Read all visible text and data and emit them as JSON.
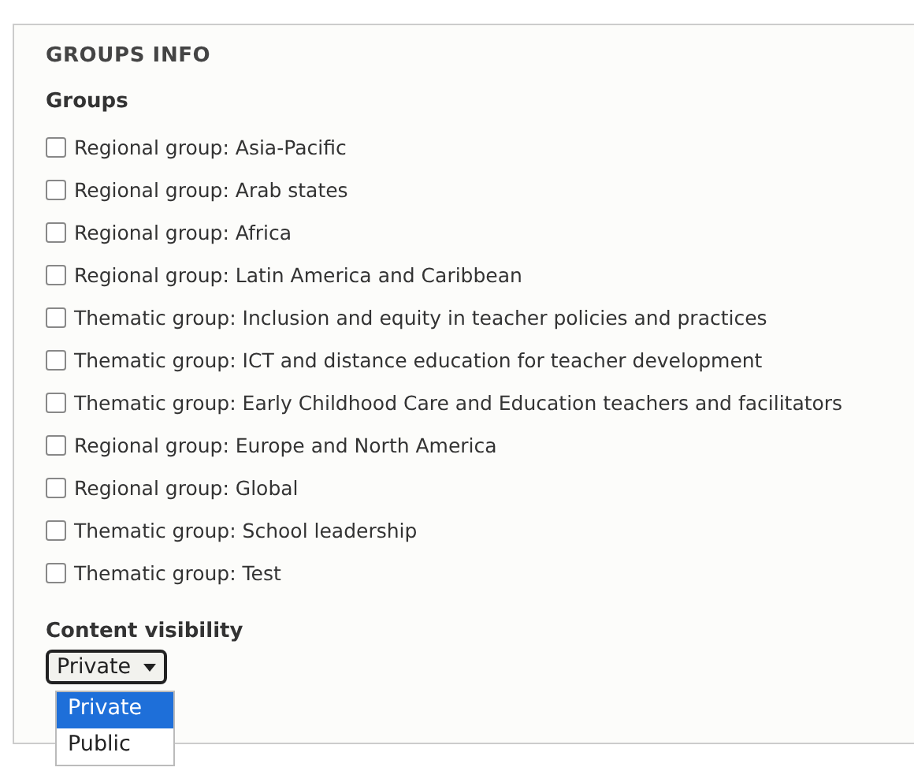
{
  "section": {
    "title": "GROUPS INFO"
  },
  "groups": {
    "label": "Groups",
    "items": [
      {
        "label": "Regional group: Asia-Pacific",
        "checked": false
      },
      {
        "label": "Regional group: Arab states",
        "checked": false
      },
      {
        "label": "Regional group: Africa",
        "checked": false
      },
      {
        "label": "Regional group: Latin America and Caribbean",
        "checked": false
      },
      {
        "label": "Thematic group: Inclusion and equity in teacher policies and practices",
        "checked": false
      },
      {
        "label": "Thematic group: ICT and distance education for teacher development",
        "checked": false
      },
      {
        "label": "Thematic group: Early Childhood Care and Education teachers and facilitators",
        "checked": false
      },
      {
        "label": "Regional group: Europe and North America",
        "checked": false
      },
      {
        "label": "Regional group: Global",
        "checked": false
      },
      {
        "label": "Thematic group: School leadership",
        "checked": false
      },
      {
        "label": "Thematic group: Test",
        "checked": false
      }
    ]
  },
  "visibility": {
    "label": "Content visibility",
    "value": "Private",
    "options": [
      {
        "label": "Private",
        "selected": true
      },
      {
        "label": "Public",
        "selected": false
      }
    ]
  }
}
